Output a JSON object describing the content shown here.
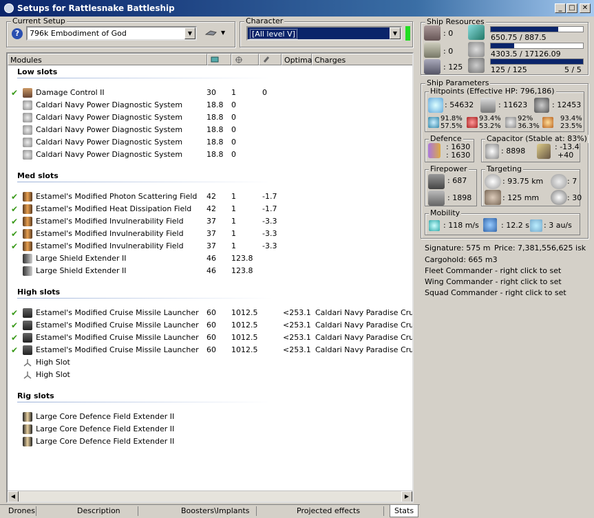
{
  "window": {
    "title": "Setups for Rattlesnake Battleship",
    "min": "_",
    "max": "□",
    "close": "✕"
  },
  "current_setup": {
    "label": "Current Setup",
    "value": "796k Embodiment of God",
    "help": "?"
  },
  "character": {
    "label": "Character",
    "value": "[All level V]",
    "status_color": "#22dd22"
  },
  "columns": {
    "modules": "Modules",
    "cpu_icon": "cpu-icon",
    "power_icon": "power-icon",
    "cap_icon": "capacitor-icon",
    "optimal": "Optimal",
    "charges": "Charges"
  },
  "sections": {
    "low": "Low slots",
    "med": "Med slots",
    "high": "High slots",
    "rig": "Rig slots"
  },
  "low_rows": [
    {
      "active": true,
      "name": "Damage Control II",
      "cpu": "30",
      "pg": "1",
      "cap": "0",
      "icon": "damage-control-icon"
    },
    {
      "active": false,
      "name": "Caldari Navy Power Diagnostic System",
      "cpu": "18.8",
      "pg": "0",
      "cap": "",
      "icon": "power-diagnostic-icon"
    },
    {
      "active": false,
      "name": "Caldari Navy Power Diagnostic System",
      "cpu": "18.8",
      "pg": "0",
      "cap": "",
      "icon": "power-diagnostic-icon"
    },
    {
      "active": false,
      "name": "Caldari Navy Power Diagnostic System",
      "cpu": "18.8",
      "pg": "0",
      "cap": "",
      "icon": "power-diagnostic-icon"
    },
    {
      "active": false,
      "name": "Caldari Navy Power Diagnostic System",
      "cpu": "18.8",
      "pg": "0",
      "cap": "",
      "icon": "power-diagnostic-icon"
    },
    {
      "active": false,
      "name": "Caldari Navy Power Diagnostic System",
      "cpu": "18.8",
      "pg": "0",
      "cap": "",
      "icon": "power-diagnostic-icon"
    }
  ],
  "med_rows": [
    {
      "active": true,
      "name": "Estamel's Modified Photon Scattering Field",
      "cpu": "42",
      "pg": "1",
      "cap": "-1.7",
      "icon": "shield-hardener-icon"
    },
    {
      "active": true,
      "name": "Estamel's Modified Heat Dissipation Field",
      "cpu": "42",
      "pg": "1",
      "cap": "-1.7",
      "icon": "shield-hardener-icon"
    },
    {
      "active": true,
      "name": "Estamel's Modified Invulnerability Field",
      "cpu": "37",
      "pg": "1",
      "cap": "-3.3",
      "icon": "shield-hardener-icon"
    },
    {
      "active": true,
      "name": "Estamel's Modified Invulnerability Field",
      "cpu": "37",
      "pg": "1",
      "cap": "-3.3",
      "icon": "shield-hardener-icon"
    },
    {
      "active": true,
      "name": "Estamel's Modified Invulnerability Field",
      "cpu": "37",
      "pg": "1",
      "cap": "-3.3",
      "icon": "shield-hardener-icon"
    },
    {
      "active": false,
      "name": "Large Shield Extender II",
      "cpu": "46",
      "pg": "123.8",
      "cap": "",
      "icon": "shield-extender-icon"
    },
    {
      "active": false,
      "name": "Large Shield Extender II",
      "cpu": "46",
      "pg": "123.8",
      "cap": "",
      "icon": "shield-extender-icon"
    }
  ],
  "high_rows": [
    {
      "active": true,
      "name": "Estamel's Modified Cruise Missile Launcher",
      "cpu": "60",
      "pg": "1012.5",
      "cap": "",
      "optimal": "<253.1",
      "charges": "Caldari Navy Paradise Cruise M",
      "icon": "missile-launcher-icon"
    },
    {
      "active": true,
      "name": "Estamel's Modified Cruise Missile Launcher",
      "cpu": "60",
      "pg": "1012.5",
      "cap": "",
      "optimal": "<253.1",
      "charges": "Caldari Navy Paradise Cruise M",
      "icon": "missile-launcher-icon"
    },
    {
      "active": true,
      "name": "Estamel's Modified Cruise Missile Launcher",
      "cpu": "60",
      "pg": "1012.5",
      "cap": "",
      "optimal": "<253.1",
      "charges": "Caldari Navy Paradise Cruise M",
      "icon": "missile-launcher-icon"
    },
    {
      "active": true,
      "name": "Estamel's Modified Cruise Missile Launcher",
      "cpu": "60",
      "pg": "1012.5",
      "cap": "",
      "optimal": "<253.1",
      "charges": "Caldari Navy Paradise Cruise M",
      "icon": "missile-launcher-icon"
    },
    {
      "active": false,
      "name": "High Slot",
      "cpu": "",
      "pg": "",
      "cap": "",
      "icon": "empty-slot-icon"
    },
    {
      "active": false,
      "name": "High Slot",
      "cpu": "",
      "pg": "",
      "cap": "",
      "icon": "empty-slot-icon"
    }
  ],
  "rig_rows": [
    {
      "active": false,
      "name": "Large Core Defence Field Extender II",
      "icon": "rig-icon"
    },
    {
      "active": false,
      "name": "Large Core Defence Field Extender II",
      "icon": "rig-icon"
    },
    {
      "active": false,
      "name": "Large Core Defence Field Extender II",
      "icon": "rig-icon"
    }
  ],
  "tabs": [
    "Drones",
    "Description",
    "Boosters\\Implants",
    "Projected effects",
    "Stats"
  ],
  "resources": {
    "label": "Ship Resources",
    "turret": "0",
    "launcher": "0",
    "calibration": "125",
    "cpu": "650.75 / 887.5",
    "cpu_fraction": 0.733,
    "power": "4303.5 / 17126.09",
    "power_fraction": 0.251,
    "drone": "125 / 125",
    "drone_fraction": 1.0,
    "slots": "5 / 5"
  },
  "params": {
    "label": "Ship Parameters",
    "hitpoints": {
      "label": "Hitpoints (Effective HP: 796,186)",
      "shield": ": 54632",
      "armor": ": 11623",
      "hull": ": 12453",
      "em1": "91.8%",
      "em2": "57.5%",
      "th1": "93.4%",
      "th2": "53.2%",
      "ki1": "92%",
      "ki2": "36.3%",
      "ex1": "93.4%",
      "ex2": "23.5%"
    },
    "defence": {
      "label": "Defence",
      "v1": ": 1630",
      "v2": ": 1630"
    },
    "capacitor": {
      "label": "Capacitor (Stable at: 83%)",
      "amount": ": 8898",
      "delta1": ": -13.4",
      "delta2": "+40"
    },
    "firepower": {
      "label": "Firepower",
      "dps": ": 687",
      "volley": ": 1898"
    },
    "targeting": {
      "label": "Targeting",
      "range": ": 93.75 km",
      "targets": ": 7",
      "resolution": ": 125 mm",
      "sensor": ": 30"
    },
    "mobility": {
      "label": "Mobility",
      "speed": ": 118 m/s",
      "align": ": 12.2 s",
      "warp": ": 3 au/s"
    }
  },
  "info": {
    "signature": "Signature: 575 m",
    "price": "Price: 7,381,556,625 isk",
    "cargohold": "Cargohold: 665 m3",
    "fleet": "Fleet Commander - right click to set",
    "wing": "Wing Commander - right click to set",
    "squad": "Squad Commander - right click to set"
  }
}
